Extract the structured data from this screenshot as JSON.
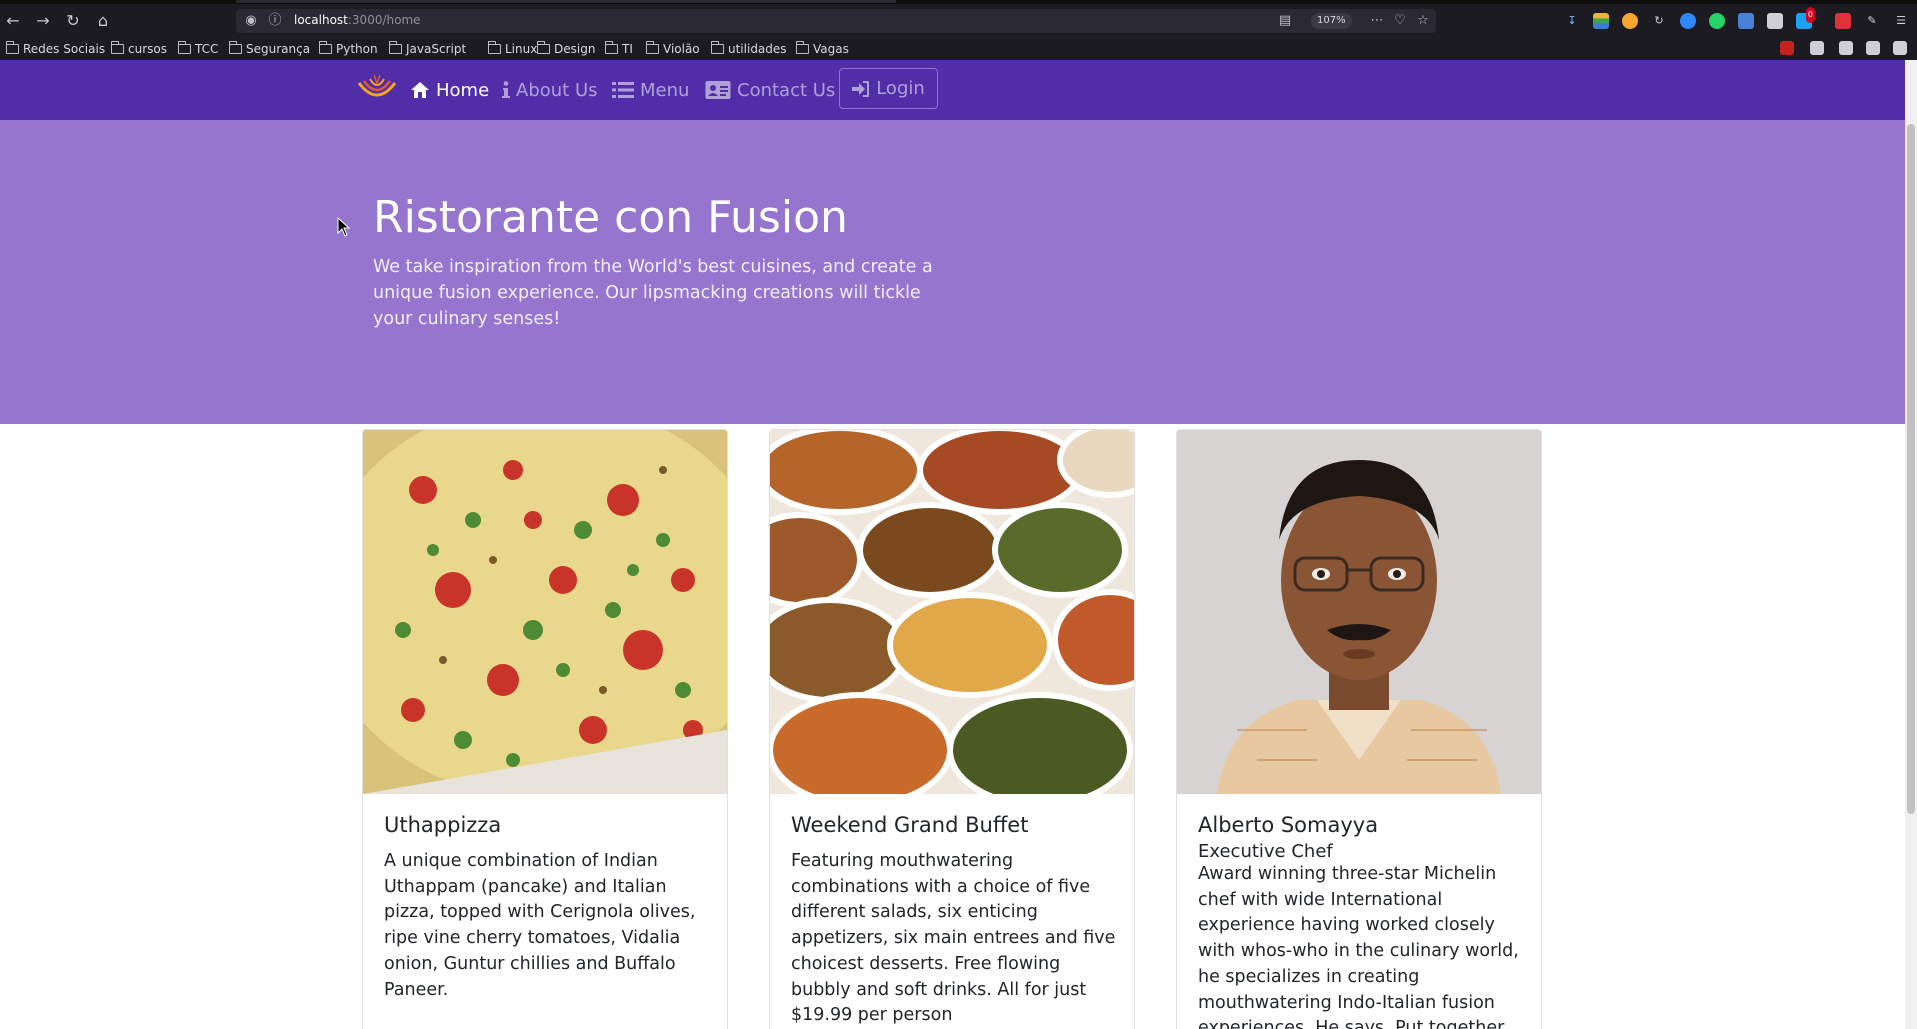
{
  "browser": {
    "url_host": "localhost",
    "url_path": ":3000/home",
    "zoom": "107%",
    "bookmarks": [
      "Redes Sociais",
      "cursos",
      "TCC",
      "Segurança",
      "Python",
      "JavaScript",
      "Linux",
      "Design",
      "TI",
      "Violão",
      "utilidades",
      "Vagas"
    ],
    "notification_count": "0"
  },
  "navbar": {
    "brand_icon": "restaurant-logo-icon",
    "items": [
      {
        "label": "Home",
        "icon": "home-icon"
      },
      {
        "label": "About Us",
        "icon": "info-icon"
      },
      {
        "label": "Menu",
        "icon": "list-icon"
      },
      {
        "label": "Contact Us",
        "icon": "address-card-icon"
      }
    ],
    "login_label": "Login"
  },
  "jumbotron": {
    "title": "Ristorante con Fusion",
    "description": "We take inspiration from the World's best cuisines, and create a unique fusion experience. Our lipsmacking creations will tickle your culinary senses!"
  },
  "cards": [
    {
      "title": "Uthappizza",
      "subtitle": "",
      "text": "A unique combination of Indian Uthappam (pancake) and Italian pizza, topped with Cerignola olives, ripe vine cherry tomatoes, Vidalia onion, Guntur chillies and Buffalo Paneer.",
      "image": "pizza-photo"
    },
    {
      "title": "Weekend Grand Buffet",
      "subtitle": "",
      "text": "Featuring mouthwatering combinations with a choice of five different salads, six enticing appetizers, six main entrees and five choicest desserts. Free flowing bubbly and soft drinks. All for just $19.99 per person",
      "image": "buffet-photo"
    },
    {
      "title": "Alberto Somayya",
      "subtitle": "Executive Chef",
      "text": "Award winning three-star Michelin chef with wide International experience having worked closely with whos-who in the culinary world, he specializes in creating mouthwatering Indo-Italian fusion experiences. He says, Put together",
      "image": "chef-portrait"
    }
  ],
  "colors": {
    "navbar": "#512da8",
    "jumbotron": "#9575cd",
    "browser_chrome": "#1c1b22"
  }
}
